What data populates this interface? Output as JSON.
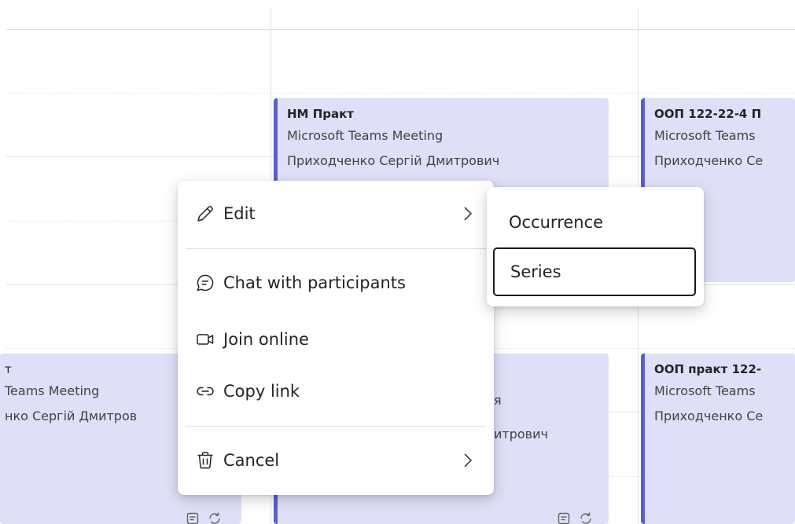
{
  "events": {
    "hm": {
      "title": "НМ Практ",
      "subtitle": "Microsoft Teams Meeting",
      "organizer": "Приходченко Сергій Дмитрович"
    },
    "oop_top": {
      "title": "ООП 122-22-4 П",
      "subtitle": "Microsoft Teams",
      "organizer": "Приходченко Се"
    },
    "left_bottom": {
      "title": "т",
      "subtitle": "Teams Meeting",
      "organizer": "нко Сергій Дмитров"
    },
    "middle_bottom": {
      "subtitle_tail": "я",
      "organizer_tail": "итрович"
    },
    "oop_bottom": {
      "title": "ООП практ 122-",
      "subtitle": "Microsoft Teams",
      "organizer": "Приходченко Се"
    }
  },
  "context_menu": {
    "edit": "Edit",
    "chat": "Chat with participants",
    "join": "Join online",
    "copy": "Copy link",
    "cancel": "Cancel"
  },
  "edit_submenu": {
    "occurrence": "Occurrence",
    "series": "Series"
  },
  "colors": {
    "accent": "#5b5fc7",
    "event_bg": "#dfe0f7",
    "focus_border": "#1a1a1a"
  },
  "icons": {
    "edit": "pencil-icon",
    "chat": "chat-bubble-icon",
    "join": "video-camera-icon",
    "copy": "link-icon",
    "cancel": "trash-icon",
    "submenu": "chevron-right-icon",
    "event_footer": [
      "notes-icon",
      "recurring-icon"
    ]
  }
}
